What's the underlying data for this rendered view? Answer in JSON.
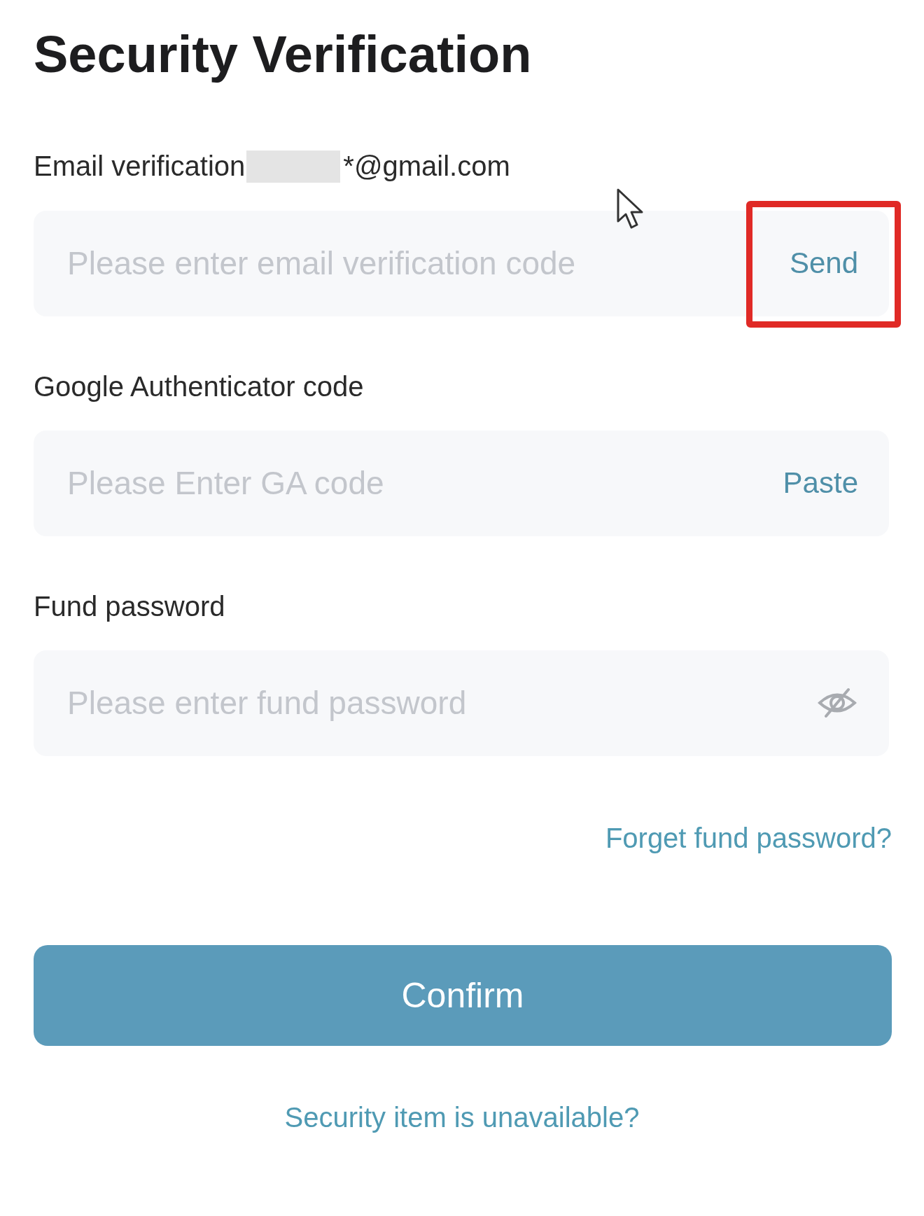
{
  "title": "Security Verification",
  "fields": [
    {
      "kind": "code",
      "label": "Email verification",
      "masked_email": "*@gmail.com",
      "placeholder": "Please enter email verification code",
      "action": "Send",
      "highlighted": true
    },
    {
      "kind": "code",
      "label": "Google Authenticator code",
      "placeholder": "Please Enter GA code",
      "action": "Paste",
      "highlighted": false
    },
    {
      "kind": "password",
      "label": "Fund password",
      "placeholder": "Please enter fund password",
      "password_visible": false
    }
  ],
  "forget_link": "Forget fund password?",
  "confirm": "Confirm",
  "unavailable_link": "Security item is unavailable?"
}
